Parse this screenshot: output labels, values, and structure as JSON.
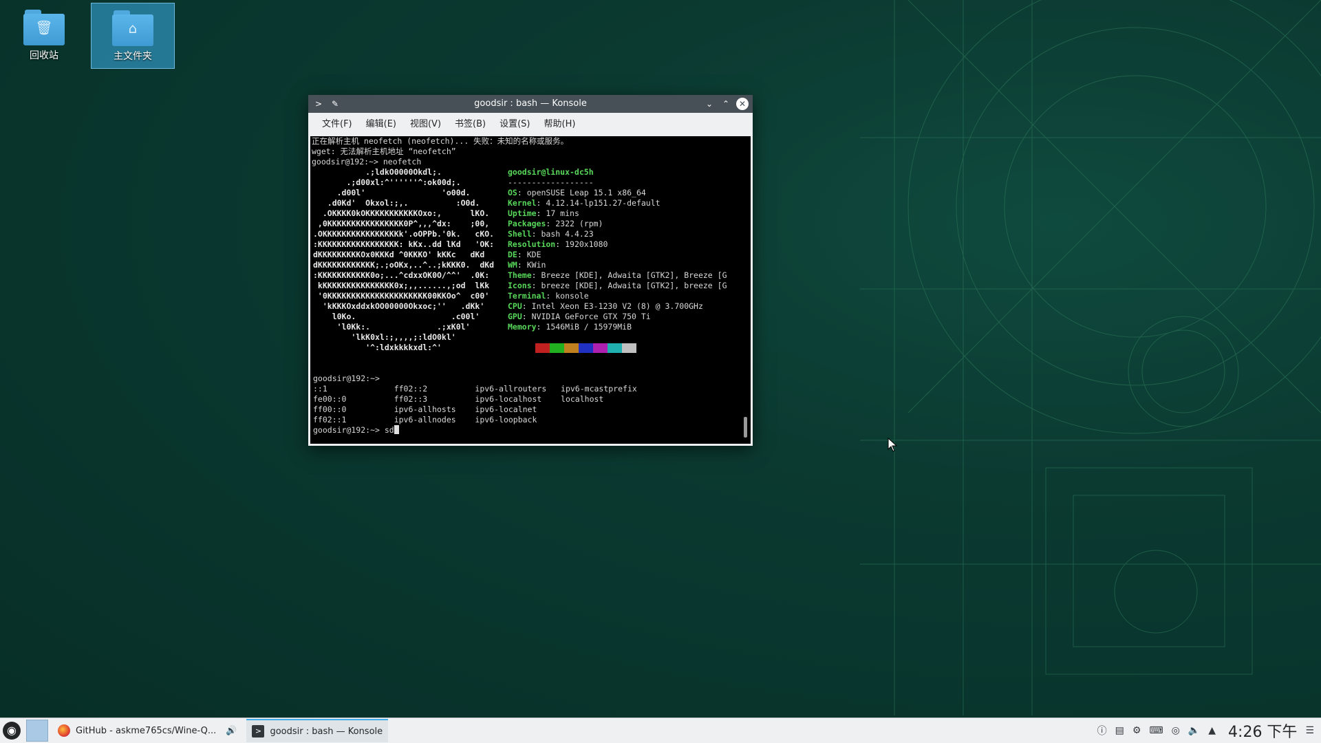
{
  "desktop": {
    "icons": [
      {
        "label": "回收站",
        "glyph": "🗑"
      },
      {
        "label": "主文件夹",
        "glyph": "⌂"
      }
    ]
  },
  "window": {
    "title": "goodsir : bash — Konsole",
    "menu": [
      "文件(F)",
      "编辑(E)",
      "视图(V)",
      "书签(B)",
      "设置(S)",
      "帮助(H)"
    ]
  },
  "terminal": {
    "pre_lines": [
      "正在解析主机 neofetch (neofetch)... 失败：未知的名称或服务。",
      "wget: 无法解析主机地址 “neofetch”",
      "goodsir@192:~> neofetch"
    ],
    "art_lines": [
      "           .;ldkO0000Okdl;.",
      "       .;d00xl:^''''''^:ok00d;.",
      "     .d00l'                'o00d.",
      "   .d0Kd'  Okxol:;,.          :O0d.",
      "  .OKKKK0kOKKKKKKKKKKKOxo:,      lKO.",
      " ,0KKKKKKKKKKKKKKKK0P^,,,^dx:    ;00,",
      ".OKKKKKKKKKKKKKKKKk'.oOPPb.'0k.   cKO.",
      ":KKKKKKKKKKKKKKKKK: kKx..dd lKd   'OK:",
      "dKKKKKKKKKOx0KKKd ^0KKKO' kKKc   dKd",
      "dKKKKKKKKKKKK;.;oOKx,..^..;kKKK0.  dKd",
      ":KKKKKKKKKKK0o;...^cdxxOK0O/^^'  .0K:",
      " kKKKKKKKKKKKKKKK0x;,,......,;od  lKk",
      " '0KKKKKKKKKKKKKKKKKKKKK00KKOo^  c00'",
      "  'kKKKOxddxkOO00000Okxoc;''   .dKk'",
      "    l0Ko.                    .c00l'",
      "     'l0Kk:.              .;xK0l'",
      "        'lkK0xl:;,,,,;:ldO0kl'",
      "           '^:ldxkkkkxdl:^'"
    ],
    "user_host": "goodsir@linux-dc5h",
    "separator": "------------------",
    "info": [
      {
        "k": "OS",
        "v": "openSUSE Leap 15.1 x86_64"
      },
      {
        "k": "Kernel",
        "v": "4.12.14-lp151.27-default"
      },
      {
        "k": "Uptime",
        "v": "17 mins"
      },
      {
        "k": "Packages",
        "v": "2322 (rpm)"
      },
      {
        "k": "Shell",
        "v": "bash 4.4.23"
      },
      {
        "k": "Resolution",
        "v": "1920x1080"
      },
      {
        "k": "DE",
        "v": "KDE"
      },
      {
        "k": "WM",
        "v": "KWin"
      },
      {
        "k": "Theme",
        "v": "Breeze [KDE], Adwaita [GTK2], Breeze [G"
      },
      {
        "k": "Icons",
        "v": "breeze [KDE], Adwaita [GTK2], breeze [G"
      },
      {
        "k": "Terminal",
        "v": "konsole"
      },
      {
        "k": "CPU",
        "v": "Intel Xeon E3-1230 V2 (8) @ 3.700GHz"
      },
      {
        "k": "GPU",
        "v": "NVIDIA GeForce GTX 750 Ti"
      },
      {
        "k": "Memory",
        "v": "1546MiB / 15979MiB"
      }
    ],
    "palette": [
      "#000000",
      "#c02020",
      "#20b020",
      "#c08020",
      "#2030c0",
      "#b020b0",
      "#20b0b0",
      "#c0c0c0"
    ],
    "post_lines": [
      "",
      "goodsir@192:~>",
      "::1              ff02::2          ipv6-allrouters   ipv6-mcastprefix",
      "fe00::0          ff02::3          ipv6-localhost    localhost",
      "ff00::0          ipv6-allhosts    ipv6-localnet",
      "ff02::1          ipv6-allnodes    ipv6-loopback"
    ],
    "prompt": "goodsir@192:~> ",
    "input": "sd"
  },
  "taskbar": {
    "tasks": [
      {
        "label": "GitHub - askme765cs/Wine-Q..."
      },
      {
        "label": "goodsir : bash — Konsole"
      }
    ],
    "clock": "4:26 下午"
  }
}
